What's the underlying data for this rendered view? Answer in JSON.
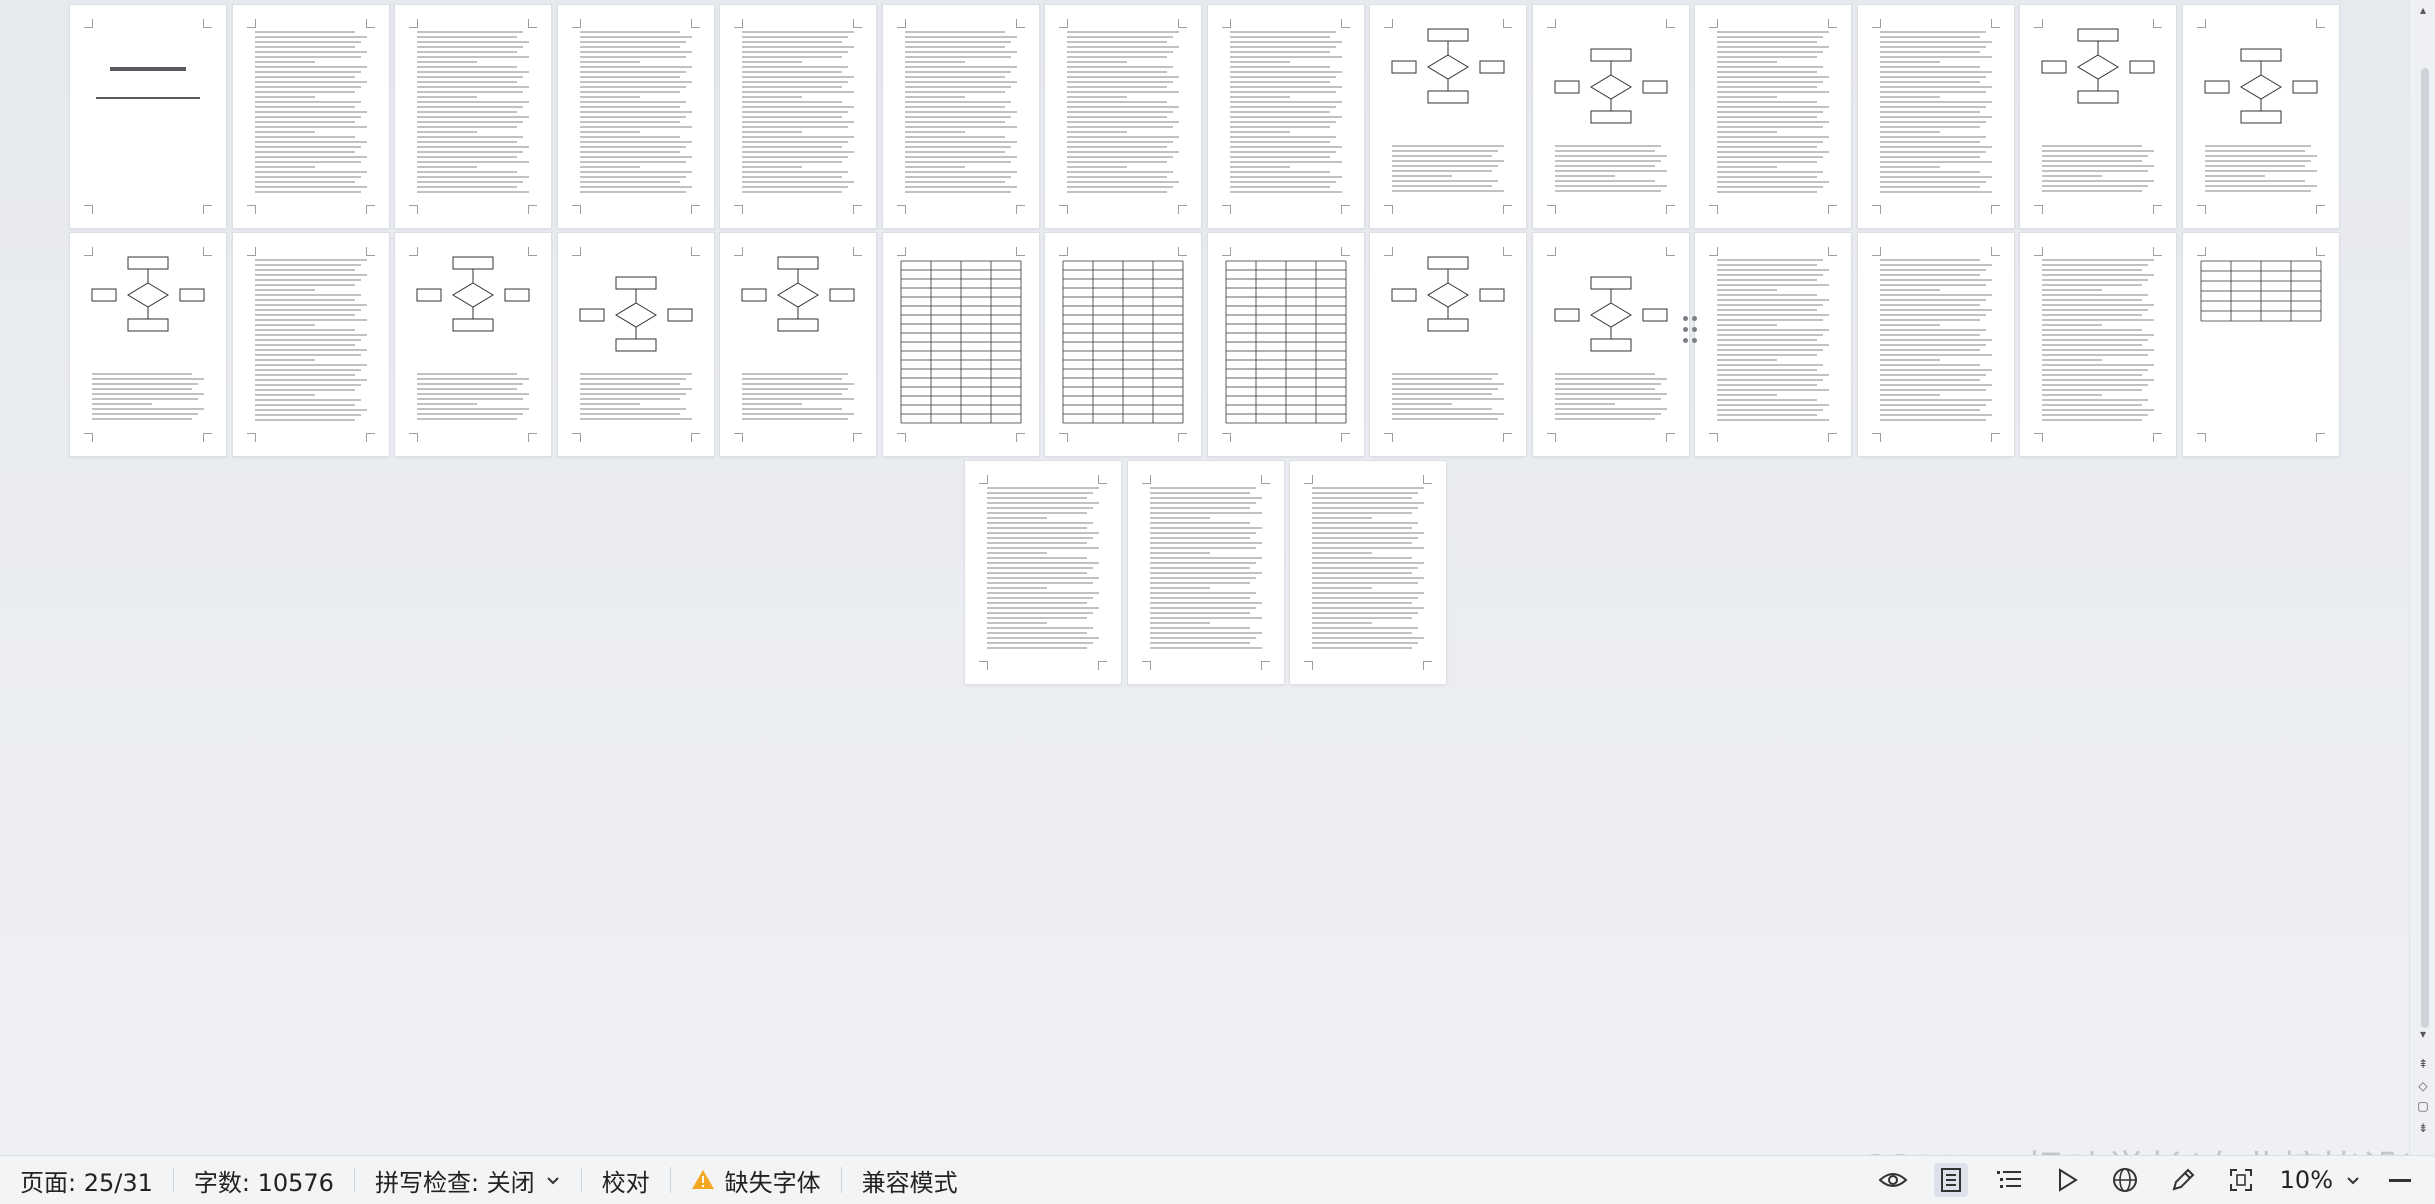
{
  "status": {
    "page_label": "页面: 25/31",
    "word_count_label": "字数: 10576",
    "spell_check_label": "拼写检查: 关闭",
    "proofread_label": "校对",
    "missing_fonts_label": "缺失字体",
    "compat_mode_label": "兼容模式",
    "zoom_label": "10%"
  },
  "watermark": "CSDN @枫叶学长(专业接毕设)",
  "icons": {
    "warning": "warning-icon",
    "eye": "eye-icon",
    "page_view": "page-view-icon",
    "outline": "outline-icon",
    "play": "play-icon",
    "web": "globe-icon",
    "pen": "pen-icon",
    "fit": "fit-page-icon",
    "chevron": "chevron-down-icon"
  },
  "colors": {
    "warning": "#f5a623",
    "active_view_bg": "#dde2ea"
  },
  "document": {
    "total_pages": 31,
    "current_page": 25,
    "row_counts": [
      14,
      14,
      3
    ]
  }
}
